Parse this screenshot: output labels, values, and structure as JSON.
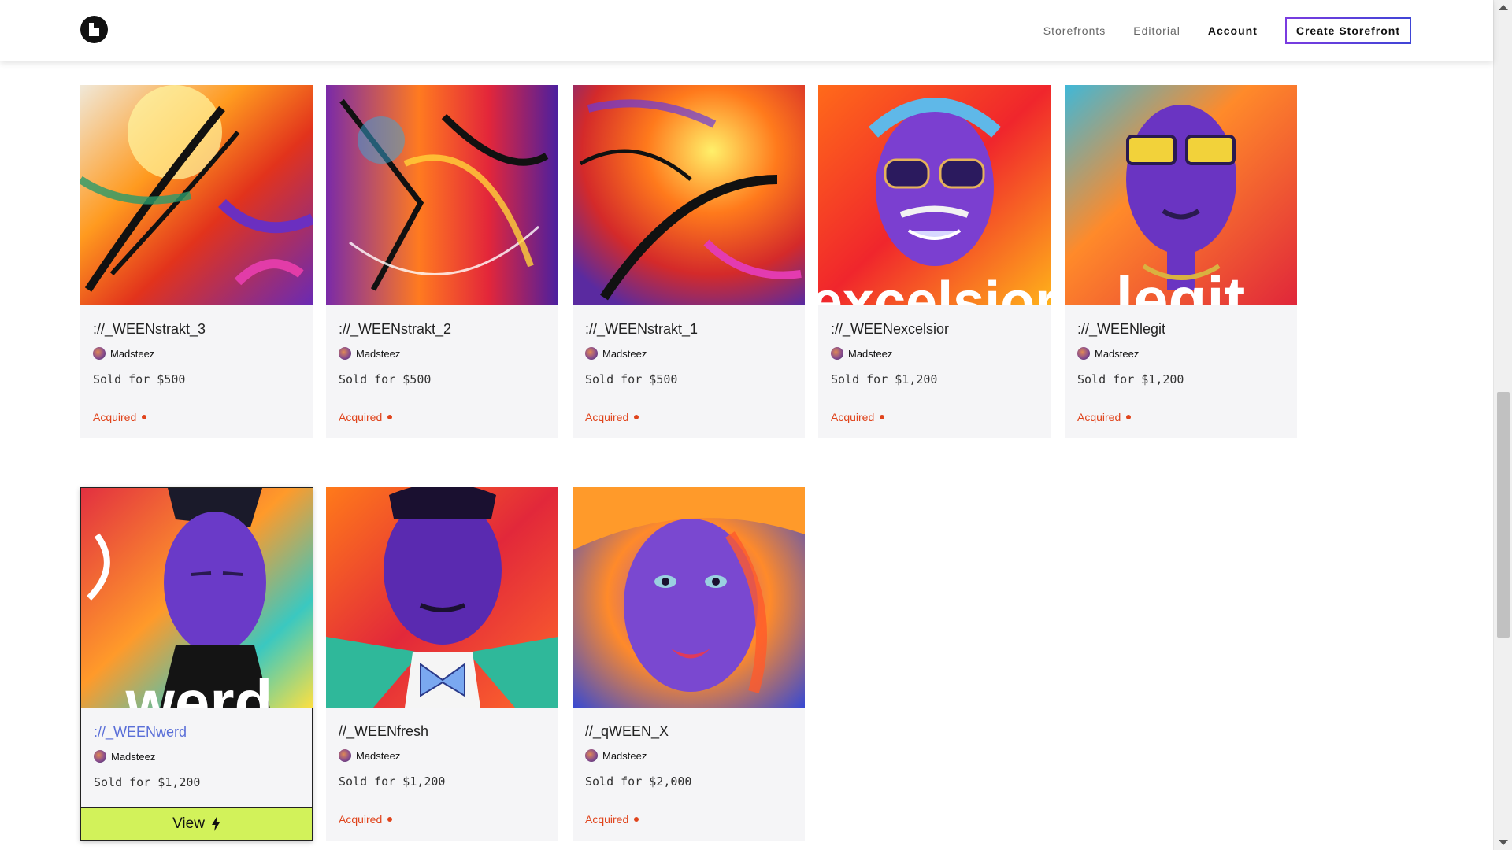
{
  "header": {
    "logo_name": "brand-logo",
    "nav": [
      {
        "label": "Storefronts"
      },
      {
        "label": "Editorial"
      },
      {
        "label": "Account"
      }
    ],
    "cta_label": "Create Storefront"
  },
  "cards": [
    {
      "title": "://_WEENstrakt_3",
      "creator": "Madsteez",
      "price": "Sold for $500",
      "status": "Acquired"
    },
    {
      "title": "://_WEENstrakt_2",
      "creator": "Madsteez",
      "price": "Sold for $500",
      "status": "Acquired"
    },
    {
      "title": "://_WEENstrakt_1",
      "creator": "Madsteez",
      "price": "Sold for $500",
      "status": "Acquired"
    },
    {
      "title": "://_WEENexcelsior",
      "creator": "Madsteez",
      "price": "Sold for $1,200",
      "status": "Acquired"
    },
    {
      "title": "://_WEENlegit",
      "creator": "Madsteez",
      "price": "Sold for $1,200",
      "status": "Acquired"
    },
    {
      "title": "://_WEENwerd",
      "creator": "Madsteez",
      "price": "Sold for $1,200",
      "view_label": "View"
    },
    {
      "title": "//_WEENfresh",
      "creator": "Madsteez",
      "price": "Sold for $1,200",
      "status": "Acquired"
    },
    {
      "title": "//_qWEEN_X",
      "creator": "Madsteez",
      "price": "Sold for $2,000",
      "status": "Acquired"
    }
  ],
  "art_overlays": {
    "excelsior": "excelsior",
    "legit": "legit",
    "werd": "werd"
  },
  "colors": {
    "accent_status": "#e0441c",
    "view_button": "#d2f25a",
    "cta_border": "#4a3cd1"
  }
}
